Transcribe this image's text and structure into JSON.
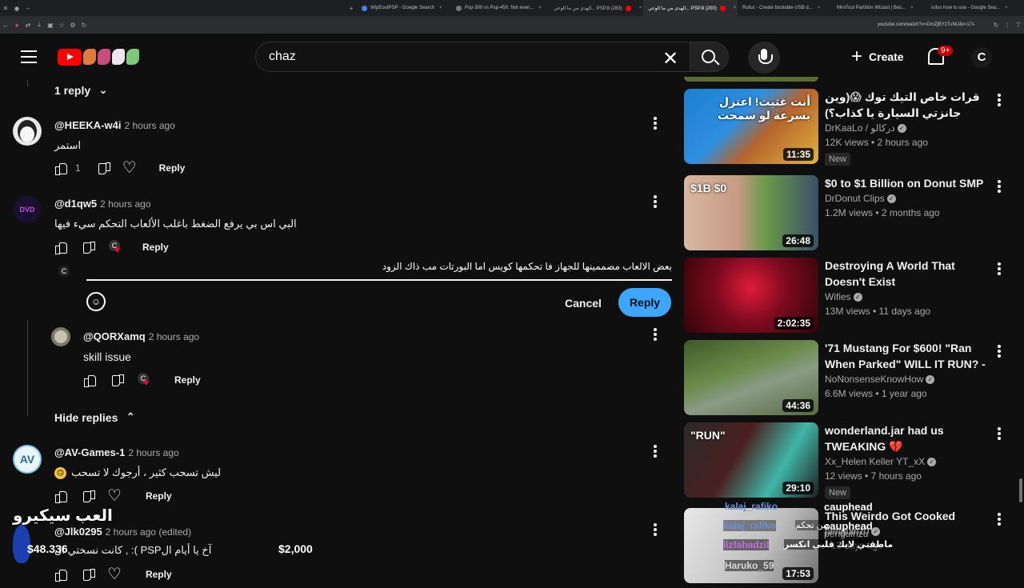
{
  "browser": {
    "tabs": [
      {
        "label": "WipEoutPSP - Google Search"
      },
      {
        "label": "Psp-300 vs Psp-450. Not even..."
      },
      {
        "label": "الهدى من ما الوعي... PSP.8 (283)"
      },
      {
        "label": "الهدى من ما الوعي... PSP.8 (200)"
      },
      {
        "label": "Rufus - Create bootable USB d..."
      },
      {
        "label": "MiniTool Partition Wizard | Bes..."
      },
      {
        "label": "rufus how to use - Google Sea..."
      }
    ],
    "url": "youtube.com/watch?v=DmZjBYzTuNU&t=17s"
  },
  "header": {
    "search_value": "chaz",
    "create_label": "Create",
    "notif_count": "9+",
    "avatar_letter": "C"
  },
  "comments": {
    "replies_toggle_1": "1 reply",
    "c1": {
      "author": "@HEEKA-w4i",
      "time": "2 hours ago",
      "text": "استمر",
      "likes": "1",
      "reply": "Reply"
    },
    "c2": {
      "author": "@d1qw5",
      "time": "2 hours ago",
      "text": "البي اس بي يرفع الضغط باغلب الألعاب التحكم سيء فيها",
      "reply": "Reply"
    },
    "reply_box": {
      "value": "بعض الالعاب مصممينها للجهاز فا تحكمها كويس اما البورتات مب ذاك الزود",
      "cancel": "Cancel",
      "submit": "Reply"
    },
    "c3": {
      "author": "@QORXamq",
      "time": "2 hours ago",
      "text": "skill issue",
      "reply": "Reply"
    },
    "hide_replies": "Hide replies",
    "c4": {
      "author": "@AV-Games-1",
      "time": "2 hours ago",
      "text": "ليش تسحب كثير ، أرجوك لا تسحب",
      "reply": "Reply"
    },
    "c5": {
      "author": "@Jlk0295",
      "time": "2 hours ago (edited)",
      "text": "آخ يا أيام الPSP ): , كانت نسختي ال",
      "reply": "Reply"
    }
  },
  "overlay": {
    "stream_title": "العب سيكيرو",
    "amount_left": "$48.336",
    "amount_right": "$2,000",
    "chat": [
      {
        "user": "kalaj_rafiko",
        "msg": "مين تحكم"
      },
      {
        "user": "lizfahadzil",
        "msg": "ماطقتي لابك قلبي انكسر"
      },
      {
        "user": "Haruko_59",
        "msg": ""
      }
    ],
    "side_chat": [
      {
        "user": "cauphead",
        "msg": ""
      },
      {
        "user": "penguinzu",
        "msg": ""
      }
    ]
  },
  "sidebar": {
    "videos": [
      {
        "title": "قرات خاص التيك توك 😱(وين جانزتي السيارة يا كذاب؟)",
        "channel": "DrKaaLo / دركالو",
        "stats": "12K views • 2 hours ago",
        "badge": "New",
        "duration": "11:35",
        "thumb_text": "أنت غثيث! اعتزل بسرعة لو سمحت"
      },
      {
        "title": "$0 to $1 Billion on Donut SMP",
        "channel": "DrDonut Clips",
        "stats": "1.2M views • 2 months ago",
        "badge": "",
        "duration": "26:48",
        "thumb_text": "$0  $1B"
      },
      {
        "title": "Destroying A World That Doesn't Exist",
        "channel": "Wifies",
        "stats": "13M views • 11 days ago",
        "badge": "",
        "duration": "2:02:35",
        "thumb_text": ""
      },
      {
        "title": "'71 Mustang For $600! \"Ran When Parked\" WILL IT RUN? - ...",
        "channel": "NoNonsenseKnowHow",
        "stats": "6.6M views • 1 year ago",
        "badge": "",
        "duration": "44:36",
        "thumb_text": ""
      },
      {
        "title": "wonderland.jar had us TWEAKING 💔",
        "channel": "Xx_Helen Keller YT_xX",
        "stats": "12 views • 7 hours ago",
        "badge": "New",
        "duration": "29:10",
        "thumb_text": "\"RUN\""
      },
      {
        "title": "This Weirdo Got Cooked",
        "channel": "penguinz0",
        "stats": "• 12 days ago",
        "badge": "",
        "duration": "17:53",
        "thumb_text": ""
      }
    ]
  }
}
